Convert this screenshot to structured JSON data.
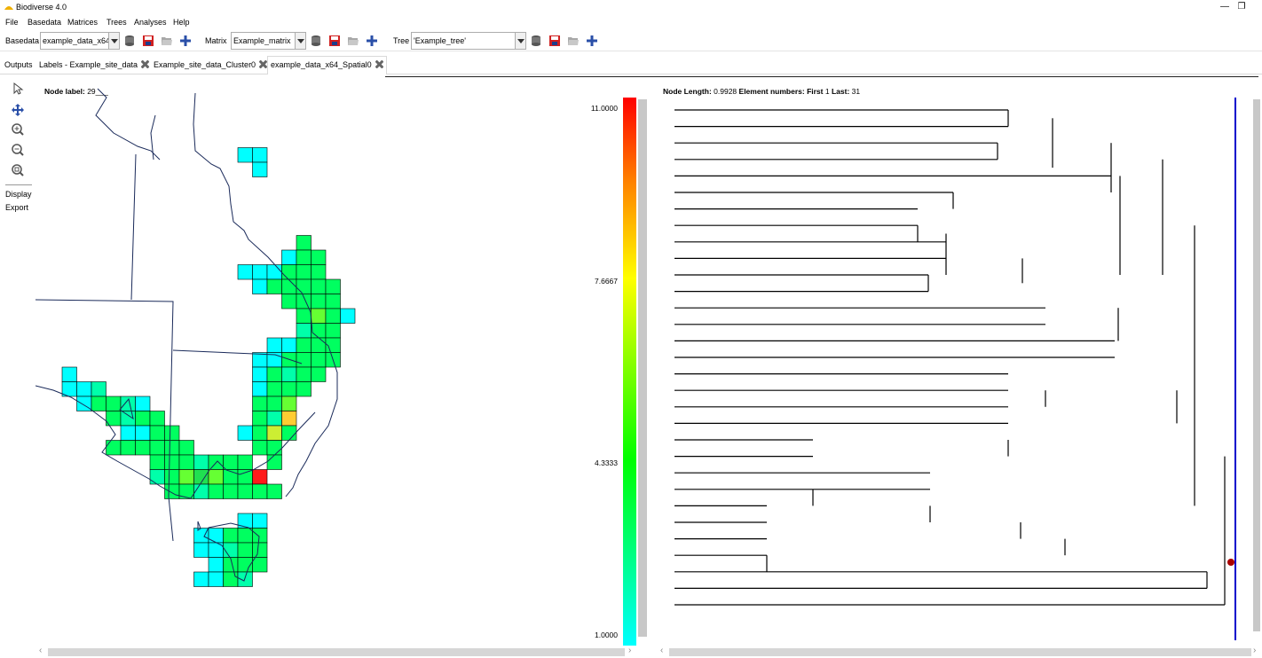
{
  "window": {
    "title": "Biodiverse 4.0",
    "minimize": "—",
    "maximize": "❐",
    "close": "✕"
  },
  "menu": {
    "items": [
      "File",
      "Basedata",
      "Matrices",
      "Trees",
      "Analyses",
      "Help"
    ]
  },
  "toolbar": {
    "basedata_label": "Basedata",
    "basedata_value": "example_data_x64",
    "matrix_label": "Matrix",
    "matrix_value": "Example_matrix",
    "tree_label": "Tree",
    "tree_value": "'Example_tree'"
  },
  "tabs": [
    "Outputs",
    "Labels - Example_site_data",
    "Example_site_data_Cluster0",
    "example_data_x64_Spatial0"
  ],
  "side": {
    "display": "Display",
    "export": "Export"
  },
  "map_panel": {
    "node_label_key": "Node label:",
    "node_label_value": "29___"
  },
  "legend": {
    "ticks": [
      "11.0000",
      "7.6667",
      "4.3333",
      "1.0000"
    ],
    "colors": [
      "#ff0000",
      "#ffff00",
      "#00ff00",
      "#00ffff"
    ]
  },
  "tree_panel": {
    "node_length_key": "Node Length:",
    "node_length_value": "0.9928",
    "element_numbers_key": "Element numbers:",
    "first_key": "First",
    "first_value": "1",
    "last_key": "Last:",
    "last_value": "31",
    "selected_line_color": "#0000cc",
    "node_marker_color": "#aa0000"
  }
}
